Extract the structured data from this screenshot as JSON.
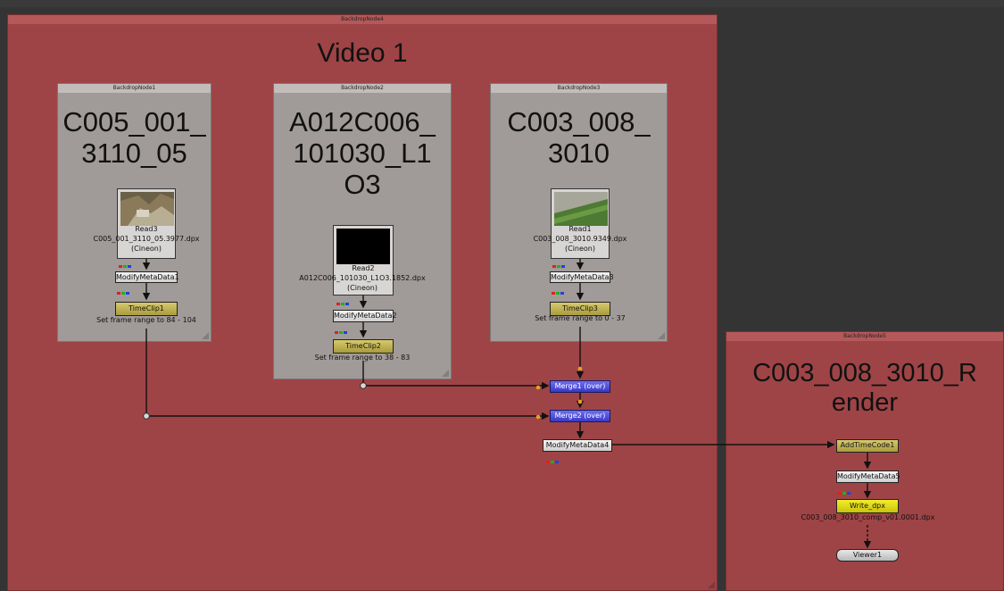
{
  "backdrops": {
    "main": {
      "label": "BackdropNode4",
      "title": "Video 1"
    },
    "bd1": {
      "label": "BackdropNode1",
      "title_line1": "C005_001_",
      "title_line2": "3110_05"
    },
    "bd2": {
      "label": "BackdropNode2",
      "title_line1": "A012C006_",
      "title_line2": "101030_L1",
      "title_line3": "O3"
    },
    "bd3": {
      "label": "BackdropNode3",
      "title_line1": "C003_008_",
      "title_line2": "3010"
    },
    "bd5": {
      "label": "BackdropNode5",
      "title_line1": "C003_008_3010_R",
      "title_line2": "ender"
    }
  },
  "nodes": {
    "read3": {
      "name": "Read3",
      "file": "C005_001_3110_05.3977.dpx",
      "format": "(Cineon)"
    },
    "read2": {
      "name": "Read2",
      "file": "A012C006_101030_L1O3.1852.dpx",
      "format": "(Cineon)"
    },
    "read1": {
      "name": "Read1",
      "file": "C003_008_3010.9349.dpx",
      "format": "(Cineon)"
    },
    "modify1": {
      "name": "ModifyMetaData1"
    },
    "modify2": {
      "name": "ModifyMetaData2"
    },
    "modify3": {
      "name": "ModifyMetaData3"
    },
    "modify4": {
      "name": "ModifyMetaData4"
    },
    "modify5": {
      "name": "ModifyMetaData5"
    },
    "timeclip1": {
      "name": "TimeClip1",
      "info": "Set frame range to 84 - 104"
    },
    "timeclip2": {
      "name": "TimeClip2",
      "info": "Set frame range to 38 - 83"
    },
    "timeclip3": {
      "name": "TimeClip3",
      "info": "Set frame range to 0 - 37"
    },
    "merge1": {
      "name": "Merge1 (over)"
    },
    "merge2": {
      "name": "Merge2 (over)"
    },
    "addtimecode": {
      "name": "AddTimeCode1"
    },
    "write": {
      "name": "Write_dpx",
      "file": "C003_008_3010_comp_v01.0001.dpx"
    },
    "viewer": {
      "name": "Viewer1"
    }
  },
  "colors": {
    "backdrop_red": "#9e4446",
    "backdrop_gray": "#a09a98",
    "canvas": "#343434",
    "merge_blue": "#4b4bdc",
    "timeclip_tan": "#c4b65a",
    "write_yellow": "#e4dd1c"
  }
}
